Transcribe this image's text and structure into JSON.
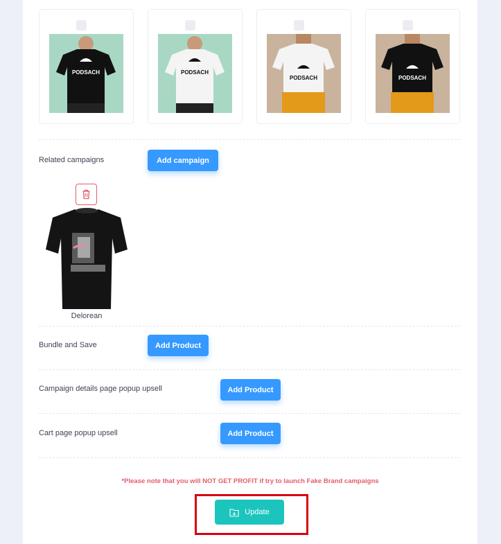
{
  "mockups": [
    {
      "icon": "tshirt-photo-icon",
      "bg": "#a8d8c4",
      "shirt": "#111111",
      "brand_color": "#ffffff",
      "brand": "PODSACH"
    },
    {
      "icon": "tshirt-photo-icon",
      "bg": "#a8d8c4",
      "shirt": "#f4f4f4",
      "brand_color": "#111111",
      "brand": "PODSACH"
    },
    {
      "icon": "tshirt-photo-icon",
      "bg": "#c9b39d",
      "shirt": "#f4f4f4",
      "brand_color": "#111111",
      "brand": "PODSACH"
    },
    {
      "icon": "tshirt-photo-icon",
      "bg": "#c9b39d",
      "shirt": "#111111",
      "brand_color": "#ffffff",
      "brand": "PODSACH"
    }
  ],
  "related_campaigns": {
    "label": "Related campaigns",
    "button": "Add campaign",
    "items": [
      {
        "name": "Delorean",
        "delete_icon": "trash-icon"
      }
    ]
  },
  "bundle_and_save": {
    "label": "Bundle and Save",
    "button": "Add Product"
  },
  "campaign_details_upsell": {
    "label": "Campaign details page popup upsell",
    "button": "Add Product"
  },
  "cart_upsell": {
    "label": "Cart page popup upsell",
    "button": "Add Product"
  },
  "warning": "*Please note that you will NOT GET PROFIT if try to launch Fake Brand campaigns",
  "update": {
    "label": "Update",
    "icon": "folder-upload-icon",
    "highlight_color": "#d9000d"
  },
  "colors": {
    "primary": "#3699ff",
    "success": "#1bc5bd",
    "danger": "#e35d6a"
  }
}
